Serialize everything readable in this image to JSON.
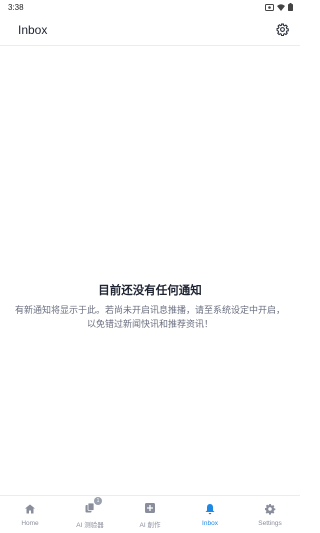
{
  "status_bar": {
    "time": "3:38"
  },
  "app_bar": {
    "title": "Inbox"
  },
  "empty_state": {
    "title": "目前还没有任何通知",
    "description": "有新通知将显示于此。若尚未开启讯息推播，请至系统设定中开启，以免错过新闻快讯和推荐资讯！"
  },
  "bottom_nav": {
    "active_color": "#1e88e5",
    "inactive_color": "#8a8e9c",
    "items": [
      {
        "label": "Home",
        "icon": "home-icon",
        "active": false
      },
      {
        "label": "AI 测验器",
        "icon": "copy-icon",
        "active": false,
        "badge": "1"
      },
      {
        "label": "AI 創作",
        "icon": "add-box-icon",
        "active": false
      },
      {
        "label": "Inbox",
        "icon": "bell-icon",
        "active": true
      },
      {
        "label": "Settings",
        "icon": "gear-icon",
        "active": false
      }
    ]
  }
}
